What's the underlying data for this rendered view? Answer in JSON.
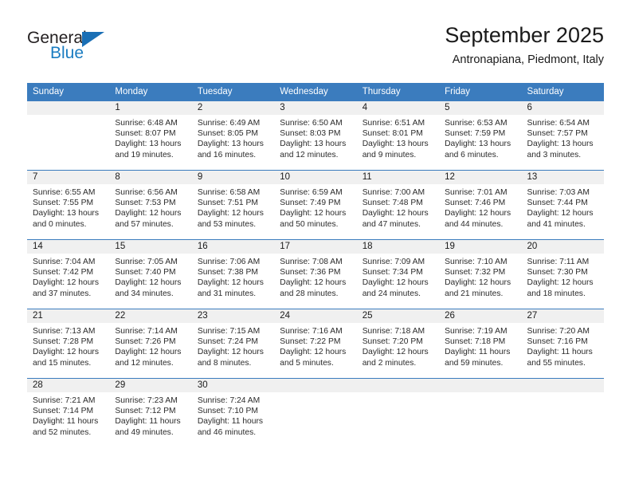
{
  "brand": {
    "name_part1": "General",
    "name_part2": "Blue"
  },
  "header": {
    "title": "September 2025",
    "subtitle": "Antronapiana, Piedmont, Italy"
  },
  "colors": {
    "header_blue": "#3b7cbe",
    "logo_blue": "#1a7cc1",
    "daynum_band": "#f0f0f0"
  },
  "weekday_headers": [
    "Sunday",
    "Monday",
    "Tuesday",
    "Wednesday",
    "Thursday",
    "Friday",
    "Saturday"
  ],
  "weeks": [
    [
      {
        "day": "",
        "sunrise": "",
        "sunset": "",
        "daylight_line1": "",
        "daylight_line2": ""
      },
      {
        "day": "1",
        "sunrise": "Sunrise: 6:48 AM",
        "sunset": "Sunset: 8:07 PM",
        "daylight_line1": "Daylight: 13 hours",
        "daylight_line2": "and 19 minutes."
      },
      {
        "day": "2",
        "sunrise": "Sunrise: 6:49 AM",
        "sunset": "Sunset: 8:05 PM",
        "daylight_line1": "Daylight: 13 hours",
        "daylight_line2": "and 16 minutes."
      },
      {
        "day": "3",
        "sunrise": "Sunrise: 6:50 AM",
        "sunset": "Sunset: 8:03 PM",
        "daylight_line1": "Daylight: 13 hours",
        "daylight_line2": "and 12 minutes."
      },
      {
        "day": "4",
        "sunrise": "Sunrise: 6:51 AM",
        "sunset": "Sunset: 8:01 PM",
        "daylight_line1": "Daylight: 13 hours",
        "daylight_line2": "and 9 minutes."
      },
      {
        "day": "5",
        "sunrise": "Sunrise: 6:53 AM",
        "sunset": "Sunset: 7:59 PM",
        "daylight_line1": "Daylight: 13 hours",
        "daylight_line2": "and 6 minutes."
      },
      {
        "day": "6",
        "sunrise": "Sunrise: 6:54 AM",
        "sunset": "Sunset: 7:57 PM",
        "daylight_line1": "Daylight: 13 hours",
        "daylight_line2": "and 3 minutes."
      }
    ],
    [
      {
        "day": "7",
        "sunrise": "Sunrise: 6:55 AM",
        "sunset": "Sunset: 7:55 PM",
        "daylight_line1": "Daylight: 13 hours",
        "daylight_line2": "and 0 minutes."
      },
      {
        "day": "8",
        "sunrise": "Sunrise: 6:56 AM",
        "sunset": "Sunset: 7:53 PM",
        "daylight_line1": "Daylight: 12 hours",
        "daylight_line2": "and 57 minutes."
      },
      {
        "day": "9",
        "sunrise": "Sunrise: 6:58 AM",
        "sunset": "Sunset: 7:51 PM",
        "daylight_line1": "Daylight: 12 hours",
        "daylight_line2": "and 53 minutes."
      },
      {
        "day": "10",
        "sunrise": "Sunrise: 6:59 AM",
        "sunset": "Sunset: 7:49 PM",
        "daylight_line1": "Daylight: 12 hours",
        "daylight_line2": "and 50 minutes."
      },
      {
        "day": "11",
        "sunrise": "Sunrise: 7:00 AM",
        "sunset": "Sunset: 7:48 PM",
        "daylight_line1": "Daylight: 12 hours",
        "daylight_line2": "and 47 minutes."
      },
      {
        "day": "12",
        "sunrise": "Sunrise: 7:01 AM",
        "sunset": "Sunset: 7:46 PM",
        "daylight_line1": "Daylight: 12 hours",
        "daylight_line2": "and 44 minutes."
      },
      {
        "day": "13",
        "sunrise": "Sunrise: 7:03 AM",
        "sunset": "Sunset: 7:44 PM",
        "daylight_line1": "Daylight: 12 hours",
        "daylight_line2": "and 41 minutes."
      }
    ],
    [
      {
        "day": "14",
        "sunrise": "Sunrise: 7:04 AM",
        "sunset": "Sunset: 7:42 PM",
        "daylight_line1": "Daylight: 12 hours",
        "daylight_line2": "and 37 minutes."
      },
      {
        "day": "15",
        "sunrise": "Sunrise: 7:05 AM",
        "sunset": "Sunset: 7:40 PM",
        "daylight_line1": "Daylight: 12 hours",
        "daylight_line2": "and 34 minutes."
      },
      {
        "day": "16",
        "sunrise": "Sunrise: 7:06 AM",
        "sunset": "Sunset: 7:38 PM",
        "daylight_line1": "Daylight: 12 hours",
        "daylight_line2": "and 31 minutes."
      },
      {
        "day": "17",
        "sunrise": "Sunrise: 7:08 AM",
        "sunset": "Sunset: 7:36 PM",
        "daylight_line1": "Daylight: 12 hours",
        "daylight_line2": "and 28 minutes."
      },
      {
        "day": "18",
        "sunrise": "Sunrise: 7:09 AM",
        "sunset": "Sunset: 7:34 PM",
        "daylight_line1": "Daylight: 12 hours",
        "daylight_line2": "and 24 minutes."
      },
      {
        "day": "19",
        "sunrise": "Sunrise: 7:10 AM",
        "sunset": "Sunset: 7:32 PM",
        "daylight_line1": "Daylight: 12 hours",
        "daylight_line2": "and 21 minutes."
      },
      {
        "day": "20",
        "sunrise": "Sunrise: 7:11 AM",
        "sunset": "Sunset: 7:30 PM",
        "daylight_line1": "Daylight: 12 hours",
        "daylight_line2": "and 18 minutes."
      }
    ],
    [
      {
        "day": "21",
        "sunrise": "Sunrise: 7:13 AM",
        "sunset": "Sunset: 7:28 PM",
        "daylight_line1": "Daylight: 12 hours",
        "daylight_line2": "and 15 minutes."
      },
      {
        "day": "22",
        "sunrise": "Sunrise: 7:14 AM",
        "sunset": "Sunset: 7:26 PM",
        "daylight_line1": "Daylight: 12 hours",
        "daylight_line2": "and 12 minutes."
      },
      {
        "day": "23",
        "sunrise": "Sunrise: 7:15 AM",
        "sunset": "Sunset: 7:24 PM",
        "daylight_line1": "Daylight: 12 hours",
        "daylight_line2": "and 8 minutes."
      },
      {
        "day": "24",
        "sunrise": "Sunrise: 7:16 AM",
        "sunset": "Sunset: 7:22 PM",
        "daylight_line1": "Daylight: 12 hours",
        "daylight_line2": "and 5 minutes."
      },
      {
        "day": "25",
        "sunrise": "Sunrise: 7:18 AM",
        "sunset": "Sunset: 7:20 PM",
        "daylight_line1": "Daylight: 12 hours",
        "daylight_line2": "and 2 minutes."
      },
      {
        "day": "26",
        "sunrise": "Sunrise: 7:19 AM",
        "sunset": "Sunset: 7:18 PM",
        "daylight_line1": "Daylight: 11 hours",
        "daylight_line2": "and 59 minutes."
      },
      {
        "day": "27",
        "sunrise": "Sunrise: 7:20 AM",
        "sunset": "Sunset: 7:16 PM",
        "daylight_line1": "Daylight: 11 hours",
        "daylight_line2": "and 55 minutes."
      }
    ],
    [
      {
        "day": "28",
        "sunrise": "Sunrise: 7:21 AM",
        "sunset": "Sunset: 7:14 PM",
        "daylight_line1": "Daylight: 11 hours",
        "daylight_line2": "and 52 minutes."
      },
      {
        "day": "29",
        "sunrise": "Sunrise: 7:23 AM",
        "sunset": "Sunset: 7:12 PM",
        "daylight_line1": "Daylight: 11 hours",
        "daylight_line2": "and 49 minutes."
      },
      {
        "day": "30",
        "sunrise": "Sunrise: 7:24 AM",
        "sunset": "Sunset: 7:10 PM",
        "daylight_line1": "Daylight: 11 hours",
        "daylight_line2": "and 46 minutes."
      },
      {
        "day": "",
        "sunrise": "",
        "sunset": "",
        "daylight_line1": "",
        "daylight_line2": ""
      },
      {
        "day": "",
        "sunrise": "",
        "sunset": "",
        "daylight_line1": "",
        "daylight_line2": ""
      },
      {
        "day": "",
        "sunrise": "",
        "sunset": "",
        "daylight_line1": "",
        "daylight_line2": ""
      },
      {
        "day": "",
        "sunrise": "",
        "sunset": "",
        "daylight_line1": "",
        "daylight_line2": ""
      }
    ]
  ]
}
